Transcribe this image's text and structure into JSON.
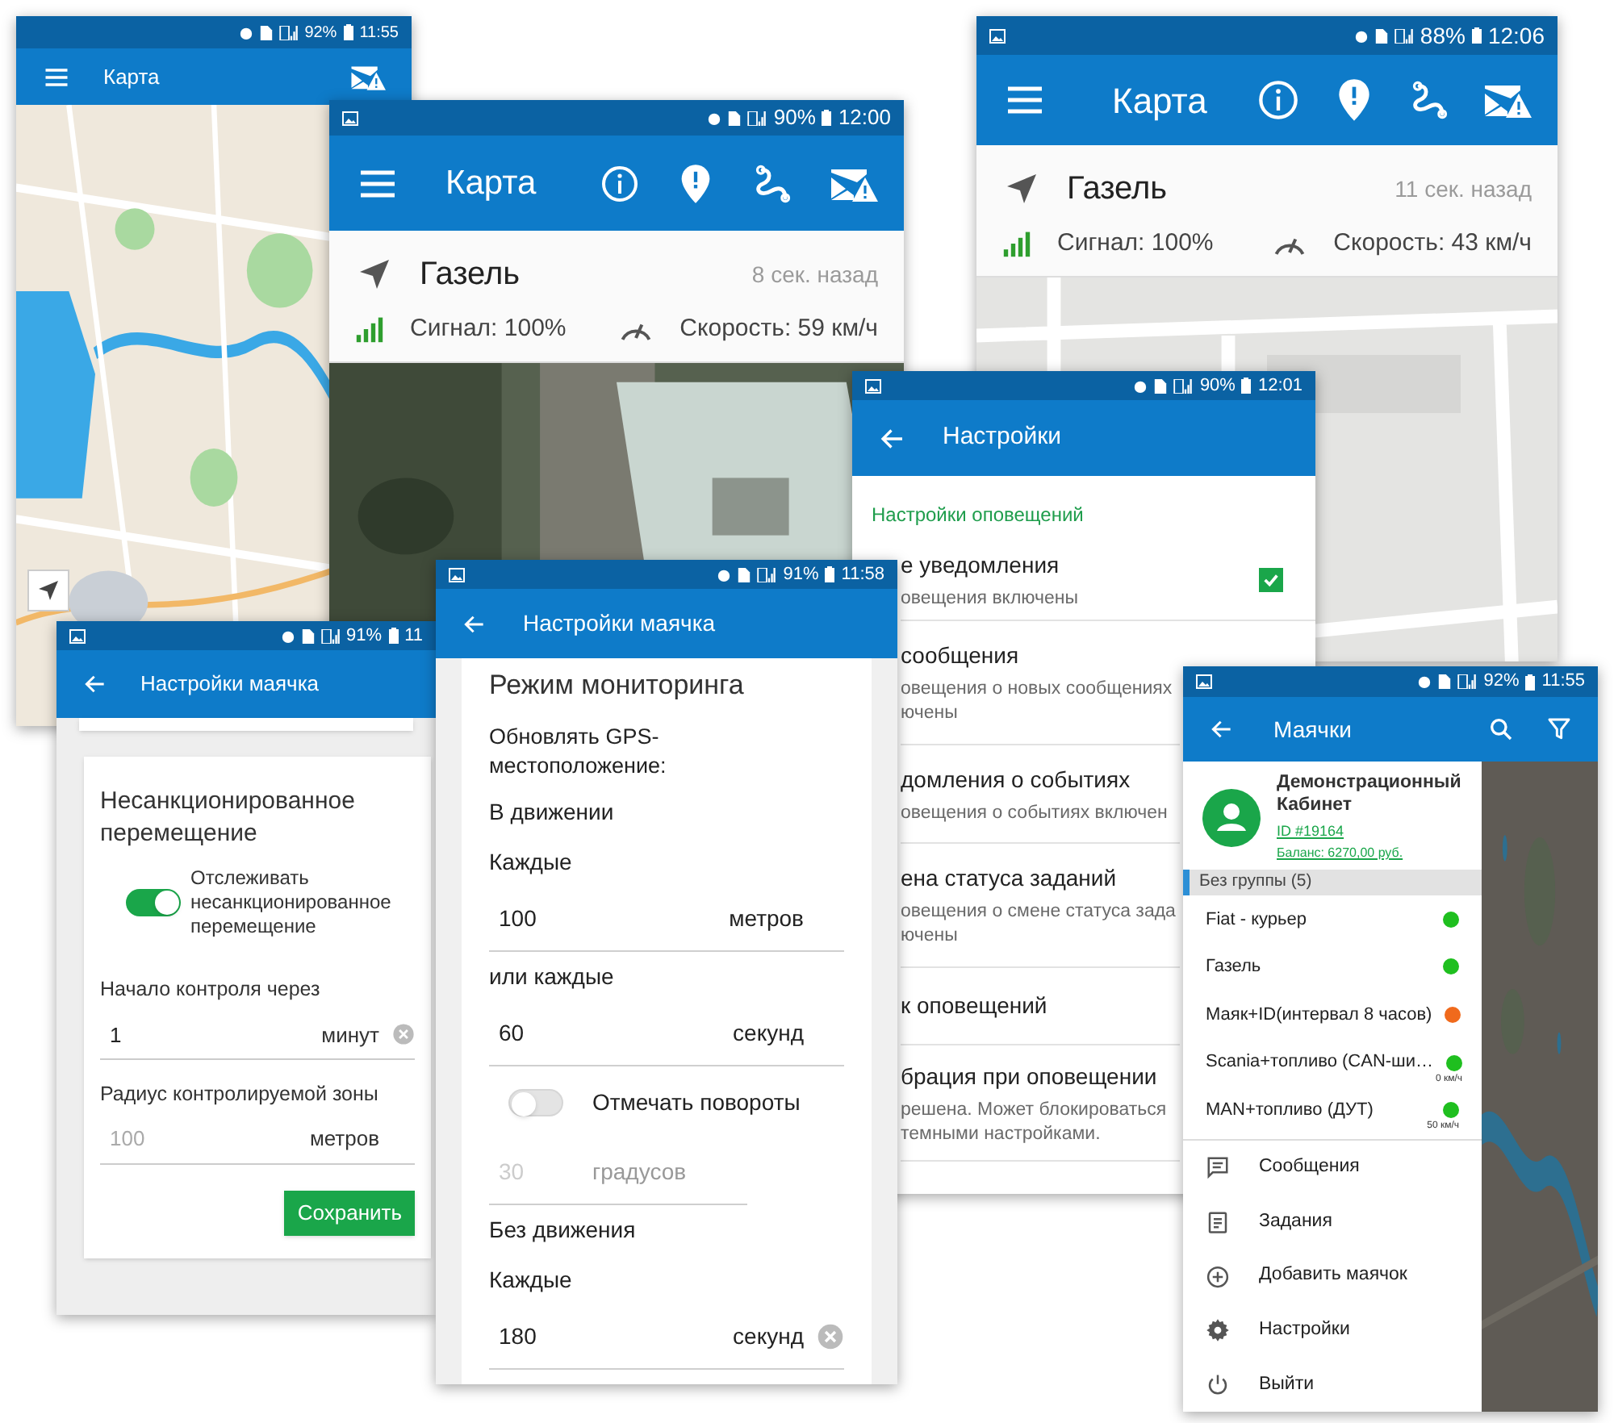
{
  "map_small": {
    "status": {
      "battery": "92%",
      "time": "11:55"
    },
    "title": "Карта"
  },
  "map_satellite": {
    "status": {
      "battery": "90%",
      "time": "12:00"
    },
    "title": "Карта",
    "vehicle": {
      "name": "Газель",
      "updated": "8 сек. назад",
      "signal": "Сигнал: 100%",
      "speed": "Скорость: 59 км/ч"
    }
  },
  "map_streets": {
    "status": {
      "battery": "88%",
      "time": "12:06"
    },
    "title": "Карта",
    "vehicle": {
      "name": "Газель",
      "updated": "11 сек. назад",
      "signal": "Сигнал: 100%",
      "speed": "Скорость: 43 км/ч"
    }
  },
  "notification_settings": {
    "status": {
      "battery": "90%",
      "time": "12:01"
    },
    "title": "Настройки",
    "section": "Настройки оповещений",
    "items": [
      {
        "title": "е уведомления",
        "subtitle": [
          "овещения включены"
        ],
        "checked": true
      },
      {
        "title": "сообщения",
        "subtitle": [
          "овещения о новых сообщениях",
          "ючены"
        ]
      },
      {
        "title": "домления о событиях",
        "subtitle": [
          "овещения о событиях включен"
        ]
      },
      {
        "title": "ена статуса заданий",
        "subtitle": [
          "овещения о смене статуса зада",
          "ючены"
        ]
      },
      {
        "title": "к оповещений"
      },
      {
        "title": "брация при оповещении",
        "subtitle": [
          "решена. Может блокироваться",
          "темными настройками."
        ]
      }
    ]
  },
  "unauthorized_movement": {
    "status": {
      "battery": "91%",
      "time": "11"
    },
    "title": "Настройки маячка",
    "heading": "Несанкционированное перемещение",
    "toggle": {
      "label": "Отслеживать несанкционированное перемещение",
      "on": true
    },
    "fields": [
      {
        "label": "Начало контроля через",
        "value": "1",
        "unit": "минут",
        "clear_button": true
      },
      {
        "label": "Радиус контролируемой зоны",
        "placeholder": "100",
        "unit": "метров",
        "clear_button": false
      }
    ],
    "button": "Сохранить"
  },
  "monitoring_mode": {
    "status": {
      "battery": "91%",
      "time": "11:58"
    },
    "title": "Настройки маячка",
    "heading": "Режим мониторинга",
    "intro": [
      "Обновлять GPS-",
      "местоположение:"
    ],
    "rows": [
      {
        "kind": "label",
        "text": "В движении"
      },
      {
        "kind": "label",
        "text": "Каждые"
      },
      {
        "kind": "field",
        "value": "100",
        "unit": "метров",
        "disabled": false,
        "clear_button": false
      },
      {
        "kind": "label",
        "text": "или каждые"
      },
      {
        "kind": "field",
        "value": "60",
        "unit": "секунд",
        "disabled": false,
        "clear_button": false
      },
      {
        "kind": "toggle",
        "label": "Отмечать повороты",
        "on": false
      },
      {
        "kind": "field",
        "value": "30",
        "unit": "градусов",
        "disabled": true,
        "clear_button": false
      },
      {
        "kind": "label",
        "text": "Без движения"
      },
      {
        "kind": "label",
        "text": "Каждые"
      },
      {
        "kind": "field",
        "value": "180",
        "unit": "секунд",
        "disabled": false,
        "clear_button": true
      }
    ]
  },
  "beacons": {
    "status": {
      "battery": "92%",
      "time": "11:55"
    },
    "title": "Маячки",
    "account": {
      "name": "Демонстрационный Кабинет",
      "id": "ID #19164",
      "balance": "Баланс: 6270,00 руб."
    },
    "group": "Без группы (5)",
    "items": [
      {
        "name": "Fiat - курьер",
        "color": "#1fbf1f"
      },
      {
        "name": "Газель",
        "color": "#1fbf1f"
      },
      {
        "name": "Маяк+ID(интервал 8 часов)",
        "color": "#f06a1c"
      },
      {
        "name": "Scania+топливо (CAN-ши…",
        "color": "#1fbf1f",
        "speed": "0 км/ч"
      },
      {
        "name": "MAN+топливо (ДУТ)",
        "color": "#1fbf1f",
        "speed": "50 км/ч"
      }
    ],
    "menu": [
      {
        "kind": "messages",
        "label": "Сообщения"
      },
      {
        "kind": "tasks",
        "label": "Задания"
      },
      {
        "kind": "add",
        "label": "Добавить маячок"
      },
      {
        "kind": "settings",
        "label": "Настройки"
      },
      {
        "kind": "logout",
        "label": "Выйти"
      }
    ]
  }
}
